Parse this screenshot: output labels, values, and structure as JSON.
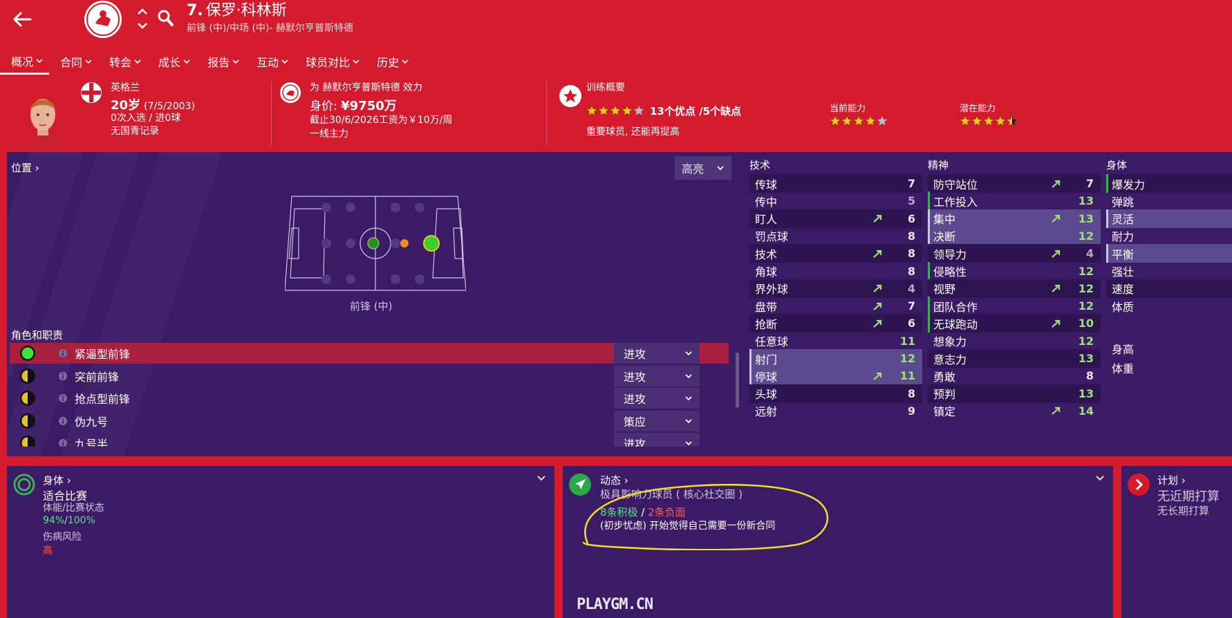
{
  "header": {
    "player_number": "7.",
    "player_name": "保罗·科林斯",
    "subtitle": "前锋 (中)/中场 (中)- 赫默尔亨普斯特德"
  },
  "tabs": [
    {
      "label": "概况",
      "active": true
    },
    {
      "label": "合同"
    },
    {
      "label": "转会"
    },
    {
      "label": "成长"
    },
    {
      "label": "报告"
    },
    {
      "label": "互动"
    },
    {
      "label": "球员对比"
    },
    {
      "label": "历史"
    }
  ],
  "info": {
    "nation": "英格兰",
    "age": "20岁",
    "dob": "(7/5/2003)",
    "caps": "0次入选 / 进0球",
    "youth": "无国青记录",
    "club_line": "为 赫默尔亨普斯特德 效力",
    "value_label": "身价: ",
    "value": "¥9750万",
    "contract": "截止30/6/2026工资为￥10万/周",
    "squad_status": "一线主力",
    "training_title": "训练概要",
    "training_stats": "13个优点 /5个缺点",
    "training_rating": 4,
    "training_note": "重要球员, 还能再提高",
    "current_ability_label": "当前能力",
    "current_ability": 4,
    "potential_ability_label": "潜在能力",
    "potential_ability": 4.5
  },
  "position": {
    "header": "位置",
    "highlight_label": "高亮",
    "position_name": "前锋 (中)",
    "roles_title": "角色和职责",
    "roles": [
      {
        "name": "紧逼型前锋",
        "duty": "进攻",
        "rating": "full",
        "selected": true
      },
      {
        "name": "突前前锋",
        "duty": "进攻",
        "rating": "half"
      },
      {
        "name": "抢点型前锋",
        "duty": "进攻",
        "rating": "half"
      },
      {
        "name": "伪九号",
        "duty": "策应",
        "rating": "half"
      },
      {
        "name": "九号半",
        "duty": "进攻",
        "rating": "half"
      }
    ]
  },
  "attributes": {
    "technical_label": "技术",
    "mental_label": "精神",
    "physical_label": "身体",
    "technical": [
      {
        "name": "传球",
        "value": "7"
      },
      {
        "name": "传中",
        "value": "5"
      },
      {
        "name": "盯人",
        "value": "6",
        "arrow": true
      },
      {
        "name": "罚点球",
        "value": "8"
      },
      {
        "name": "技术",
        "value": "8",
        "arrow": true
      },
      {
        "name": "角球",
        "value": "8"
      },
      {
        "name": "界外球",
        "value": "4",
        "arrow": true
      },
      {
        "name": "盘带",
        "value": "7",
        "arrow": true
      },
      {
        "name": "抢断",
        "value": "6",
        "arrow": true
      },
      {
        "name": "任意球",
        "value": "11"
      },
      {
        "name": "射门",
        "value": "12",
        "hl": true
      },
      {
        "name": "停球",
        "value": "11",
        "arrow": true,
        "hl": true
      },
      {
        "name": "头球",
        "value": "8"
      },
      {
        "name": "远射",
        "value": "9"
      }
    ],
    "mental": [
      {
        "name": "防守站位",
        "value": "7",
        "arrow": true
      },
      {
        "name": "工作投入",
        "value": "13",
        "bar": true
      },
      {
        "name": "集中",
        "value": "13",
        "arrow": true,
        "hl": true
      },
      {
        "name": "决断",
        "value": "12",
        "hl": true
      },
      {
        "name": "领导力",
        "value": "4",
        "arrow": true
      },
      {
        "name": "侵略性",
        "value": "12",
        "bar": true
      },
      {
        "name": "视野",
        "value": "12",
        "arrow": true
      },
      {
        "name": "团队合作",
        "value": "12",
        "bar": true
      },
      {
        "name": "无球跑动",
        "value": "10",
        "arrow": true,
        "bar": true
      },
      {
        "name": "想象力",
        "value": "12"
      },
      {
        "name": "意志力",
        "value": "13"
      },
      {
        "name": "勇敢",
        "value": "8"
      },
      {
        "name": "预判",
        "value": "13"
      },
      {
        "name": "镇定",
        "value": "14",
        "arrow": true
      }
    ],
    "physical": [
      {
        "name": "爆发力",
        "bar": true
      },
      {
        "name": "弹跳"
      },
      {
        "name": "灵活",
        "hl": true
      },
      {
        "name": "耐力"
      },
      {
        "name": "平衡",
        "hl": true
      },
      {
        "name": "强壮"
      },
      {
        "name": "速度"
      },
      {
        "name": "体质"
      }
    ],
    "physical_extra": [
      "身高",
      "体重"
    ]
  },
  "fitness": {
    "title": "身体",
    "status": "适合比赛",
    "label_a": "体能",
    "label_b": "比赛状态",
    "value_a": "94%",
    "value_b": "100%",
    "injury_label": "伤病风险",
    "injury_value": "高"
  },
  "dynamics": {
    "title": "动态",
    "subtitle": "极具影响力球员 ( 核心社交圈 )",
    "positive": "8条积极",
    "negative": "2条负面",
    "note": "(初步忧虑) 开始觉得自己需要一份新合同"
  },
  "plans": {
    "title": "计划",
    "line1": "无近期打算",
    "line2": "无长期打算"
  },
  "watermark": "PLAYGM.CN",
  "colors": {
    "header_red": "#d41b2d",
    "panel_purple": "#3b1a66",
    "green_value": "#9fe07a",
    "positive": "#5ee08a",
    "negative": "#ff5a5a",
    "annotation_yellow": "#f2e11e"
  }
}
